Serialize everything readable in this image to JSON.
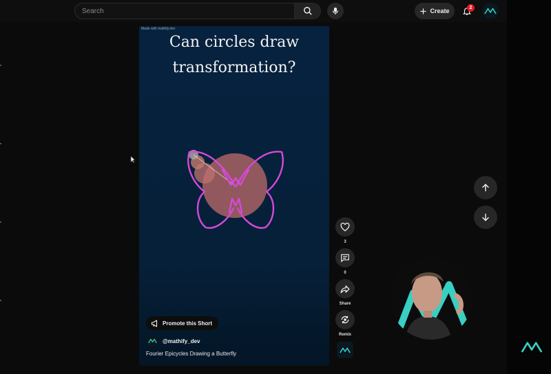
{
  "search": {
    "placeholder": "Search"
  },
  "header": {
    "create_label": "Create",
    "notification_count": "2"
  },
  "short": {
    "watermark": "Made with mathify.dev",
    "headline_line1": "Can circles draw",
    "headline_line2": "transformation?",
    "promote_label": "Promote this Short",
    "channel_handle": "@mathify_dev",
    "title": "Fourier Epicycles Drawing a Butterfly"
  },
  "actions": {
    "like_count": "3",
    "comment_count": "0",
    "share_label": "Share",
    "remix_label": "Remix"
  },
  "colors": {
    "accent_teal": "#37d0c3",
    "drawing_magenta": "#d64ad9",
    "epicycle_fill": "#b86868",
    "notification_red": "#e21b23"
  },
  "icons": [
    "search-icon",
    "mic-icon",
    "plus-icon",
    "bell-icon",
    "megaphone-icon",
    "like-icon",
    "comment-icon",
    "share-icon",
    "remix-icon",
    "arrow-up-icon",
    "arrow-down-icon"
  ]
}
